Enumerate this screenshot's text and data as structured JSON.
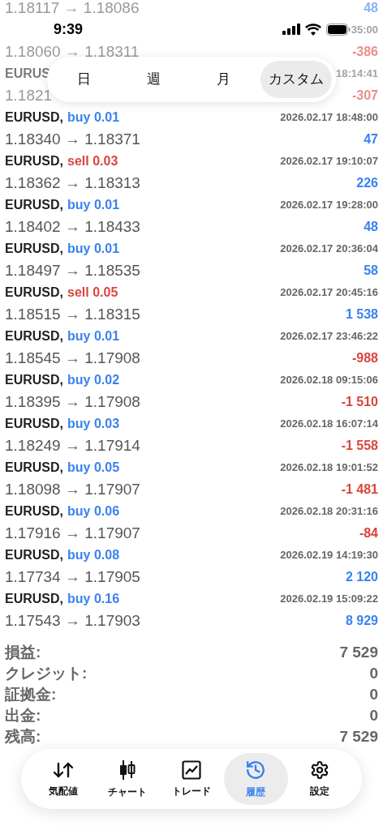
{
  "status_bar": {
    "time": "9:39"
  },
  "period_tabs": [
    {
      "label": "日",
      "selected": false
    },
    {
      "label": "週",
      "selected": false
    },
    {
      "label": "月",
      "selected": false
    },
    {
      "label": "カスタム",
      "selected": true
    }
  ],
  "faded_rows": [
    {
      "prices": "1.18117 → 1.18086",
      "profit": "48",
      "positive": true
    },
    {
      "time": "35:00",
      "prices": "1.18060 → 1.18311",
      "profit": "-386",
      "positive": false
    },
    {
      "symbol": "EURUS",
      "time": "18:14:41",
      "prices": "1.1821",
      "profit": "-307",
      "positive": false
    }
  ],
  "trades": [
    {
      "symbol": "EURUSD,",
      "sell": false,
      "order": "buy 0.01",
      "time": "2026.02.17 18:48:00",
      "prices": "1.18340 → 1.18371",
      "profit": "47",
      "positive": true
    },
    {
      "symbol": "EURUSD,",
      "sell": true,
      "order": "sell 0.03",
      "time": "2026.02.17 19:10:07",
      "prices": "1.18362 → 1.18313",
      "profit": "226",
      "positive": true
    },
    {
      "symbol": "EURUSD,",
      "sell": false,
      "order": "buy 0.01",
      "time": "2026.02.17 19:28:00",
      "prices": "1.18402 → 1.18433",
      "profit": "48",
      "positive": true
    },
    {
      "symbol": "EURUSD,",
      "sell": false,
      "order": "buy 0.01",
      "time": "2026.02.17 20:36:04",
      "prices": "1.18497 → 1.18535",
      "profit": "58",
      "positive": true
    },
    {
      "symbol": "EURUSD,",
      "sell": true,
      "order": "sell 0.05",
      "time": "2026.02.17 20:45:16",
      "prices": "1.18515 → 1.18315",
      "profit": "1 538",
      "positive": true
    },
    {
      "symbol": "EURUSD,",
      "sell": false,
      "order": "buy 0.01",
      "time": "2026.02.17 23:46:22",
      "prices": "1.18545 → 1.17908",
      "profit": "-988",
      "positive": false
    },
    {
      "symbol": "EURUSD,",
      "sell": false,
      "order": "buy 0.02",
      "time": "2026.02.18 09:15:06",
      "prices": "1.18395 → 1.17908",
      "profit": "-1 510",
      "positive": false
    },
    {
      "symbol": "EURUSD,",
      "sell": false,
      "order": "buy 0.03",
      "time": "2026.02.18 16:07:14",
      "prices": "1.18249 → 1.17914",
      "profit": "-1 558",
      "positive": false
    },
    {
      "symbol": "EURUSD,",
      "sell": false,
      "order": "buy 0.05",
      "time": "2026.02.18 19:01:52",
      "prices": "1.18098 → 1.17907",
      "profit": "-1 481",
      "positive": false
    },
    {
      "symbol": "EURUSD,",
      "sell": false,
      "order": "buy 0.06",
      "time": "2026.02.18 20:31:16",
      "prices": "1.17916 → 1.17907",
      "profit": "-84",
      "positive": false
    },
    {
      "symbol": "EURUSD,",
      "sell": false,
      "order": "buy 0.08",
      "time": "2026.02.19 14:19:30",
      "prices": "1.17734 → 1.17905",
      "profit": "2 120",
      "positive": true
    },
    {
      "symbol": "EURUSD,",
      "sell": false,
      "order": "buy 0.16",
      "time": "2026.02.19 15:09:22",
      "prices": "1.17543 → 1.17903",
      "profit": "8 929",
      "positive": true
    }
  ],
  "summary": [
    {
      "label": "損益:",
      "value": "7 529"
    },
    {
      "label": "クレジット:",
      "value": "0"
    },
    {
      "label": "証拠金:",
      "value": "0"
    },
    {
      "label": "出金:",
      "value": "0"
    },
    {
      "label": "残高:",
      "value": "7 529"
    }
  ],
  "nav": [
    {
      "kind": "quotes",
      "label": "気配値",
      "selected": false
    },
    {
      "kind": "chart",
      "label": "チャート",
      "selected": false
    },
    {
      "kind": "trade",
      "label": "トレード",
      "selected": false
    },
    {
      "kind": "history",
      "label": "履歴",
      "selected": true
    },
    {
      "kind": "settings",
      "label": "設定",
      "selected": false
    }
  ]
}
